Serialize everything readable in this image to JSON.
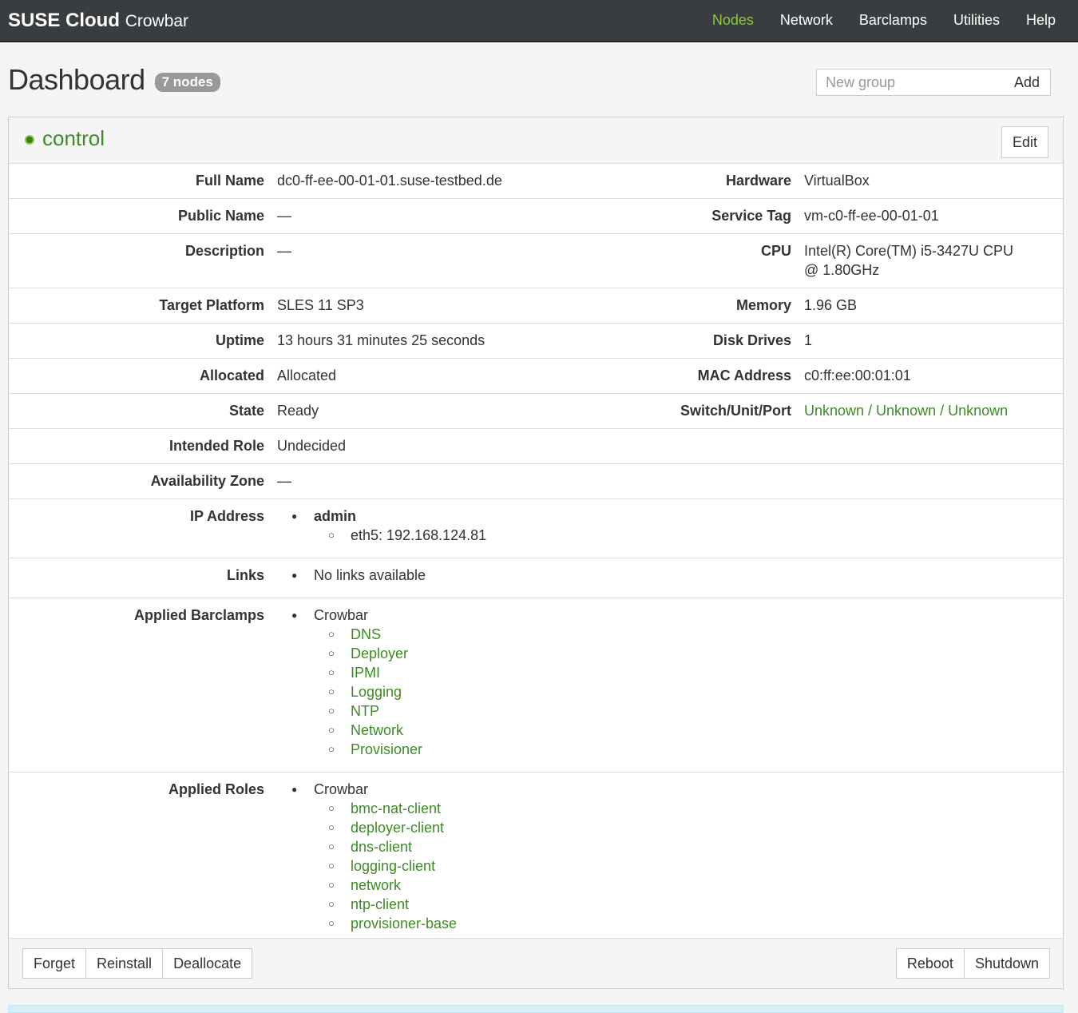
{
  "app": {
    "brand_bold": "SUSE Cloud",
    "brand_light": "Crowbar",
    "nav": [
      "Nodes",
      "Network",
      "Barclamps",
      "Utilities",
      "Help"
    ],
    "nav_active": "Nodes",
    "accent_color": "#8dc63f",
    "link_color": "#3d8b25"
  },
  "header": {
    "title": "Dashboard",
    "node_count": "7 nodes",
    "group_placeholder": "New group",
    "add_label": "Add"
  },
  "group": {
    "name": "control",
    "edit_label": "Edit",
    "status_icon": "status-ready-icon"
  },
  "details": {
    "full_name": {
      "label": "Full Name",
      "value": "dc0-ff-ee-00-01-01.suse-testbed.de"
    },
    "hardware": {
      "label": "Hardware",
      "value": "VirtualBox"
    },
    "public_name": {
      "label": "Public Name",
      "value": "—"
    },
    "service_tag": {
      "label": "Service Tag",
      "value": "vm-c0-ff-ee-00-01-01"
    },
    "description": {
      "label": "Description",
      "value": "—"
    },
    "cpu": {
      "label": "CPU",
      "value": "Intel(R) Core(TM) i5-3427U CPU @ 1.80GHz"
    },
    "target_platform": {
      "label": "Target Platform",
      "value": "SLES 11 SP3"
    },
    "memory": {
      "label": "Memory",
      "value": "1.96 GB"
    },
    "uptime": {
      "label": "Uptime",
      "value": "13 hours 31 minutes 25 seconds"
    },
    "disk_drives": {
      "label": "Disk Drives",
      "value": "1"
    },
    "allocated": {
      "label": "Allocated",
      "value": "Allocated"
    },
    "mac_address": {
      "label": "MAC Address",
      "value": "c0:ff:ee:00:01:01"
    },
    "state": {
      "label": "State",
      "value": "Ready"
    },
    "switch": {
      "label": "Switch/Unit/Port",
      "value": "Unknown / Unknown / Unknown"
    },
    "intended_role": {
      "label": "Intended Role",
      "value": "Undecided"
    },
    "availability_zone": {
      "label": "Availability Zone",
      "value": "—"
    },
    "ip_address": {
      "label": "IP Address",
      "network": "admin",
      "interface": "eth5: 192.168.124.81"
    },
    "links": {
      "label": "Links",
      "value": "No links available"
    },
    "applied_barclamps": {
      "label": "Applied Barclamps",
      "group": "Crowbar",
      "items": [
        "DNS",
        "Deployer",
        "IPMI",
        "Logging",
        "NTP",
        "Network",
        "Provisioner"
      ]
    },
    "applied_roles": {
      "label": "Applied Roles",
      "group": "Crowbar",
      "items": [
        "bmc-nat-client",
        "deployer-client",
        "dns-client",
        "logging-client",
        "network",
        "ntp-client",
        "provisioner-base"
      ]
    }
  },
  "actions": {
    "forget": "Forget",
    "reinstall": "Reinstall",
    "deallocate": "Deallocate",
    "reboot": "Reboot",
    "shutdown": "Shutdown"
  }
}
